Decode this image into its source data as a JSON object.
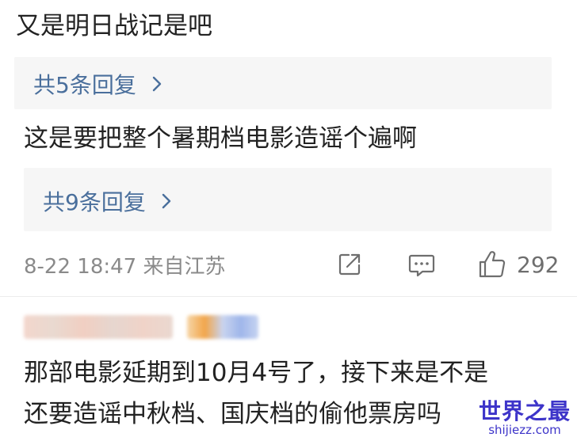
{
  "thread": {
    "comment1_text": "又是明日战记是吧",
    "comment1_replies": "共5条回复",
    "comment2_text": "这是要把整个暑期档电影造谣个遍啊",
    "comment2_replies": "共9条回复"
  },
  "meta": {
    "timestamp_location": "8-22 18:47 来自江苏",
    "like_count": "292"
  },
  "next_comment": {
    "line1": "那部电影延期到10月4号了，接下来是不是",
    "line2": "还要造谣中秋档、国庆档的偷他票房吗"
  },
  "watermark": {
    "title": "世界之最",
    "url": "shijiezz.com"
  },
  "colors": {
    "link": "#4a6f9c",
    "meta": "#8a8a8a",
    "reply_bg": "#f6f6f6",
    "watermark": "#3d34c9"
  },
  "icons": [
    "chevron-right-icon",
    "share-icon",
    "comment-icon",
    "thumbs-up-icon"
  ]
}
